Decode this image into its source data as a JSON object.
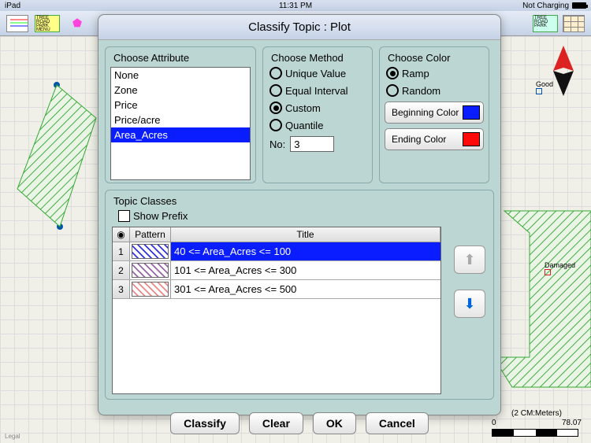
{
  "status": {
    "device": "iPad",
    "time": "11:31 PM",
    "charge": "Not Charging"
  },
  "toolbar": {
    "legend_hint": "TREE\nROAD\nPARK\nMENU",
    "legend_mini": "TREE\nROAD\nPARK"
  },
  "map": {
    "marker_good": "Good",
    "marker_damaged": "Damaged"
  },
  "scale": {
    "label": "(2 CM:Meters)",
    "start": "0",
    "end": "78.07"
  },
  "legal": "Legal",
  "dialog": {
    "title": "Classify Topic : Plot",
    "attr": {
      "label": "Choose Attribute",
      "items": [
        "None",
        "Zone",
        "Price",
        "Price/acre",
        "Area_Acres"
      ],
      "selected": 4
    },
    "method": {
      "label": "Choose Method",
      "options": [
        "Unique Value",
        "Equal Interval",
        "Custom",
        "Quantile"
      ],
      "selected": 2,
      "no_label": "No:",
      "no_value": "3"
    },
    "color": {
      "label": "Choose Color",
      "options": [
        "Ramp",
        "Random"
      ],
      "selected": 0,
      "begin_label": "Beginning Color",
      "begin_hex": "#0a1dff",
      "end_label": "Ending Color",
      "end_hex": "#ff0a0a"
    },
    "classes": {
      "label": "Topic Classes",
      "show_prefix": "Show Prefix",
      "show_prefix_checked": false,
      "eye_header": "👁",
      "pattern_header": "Pattern",
      "title_header": "Title",
      "rows": [
        {
          "n": "1",
          "title": "40 <= Area_Acres <= 100",
          "pattern": "blue",
          "selected": true
        },
        {
          "n": "2",
          "title": "101 <= Area_Acres <= 300",
          "pattern": "purple",
          "selected": false
        },
        {
          "n": "3",
          "title": "301 <= Area_Acres <= 500",
          "pattern": "red",
          "selected": false
        }
      ]
    },
    "buttons": {
      "classify": "Classify",
      "clear": "Clear",
      "ok": "OK",
      "cancel": "Cancel"
    }
  }
}
